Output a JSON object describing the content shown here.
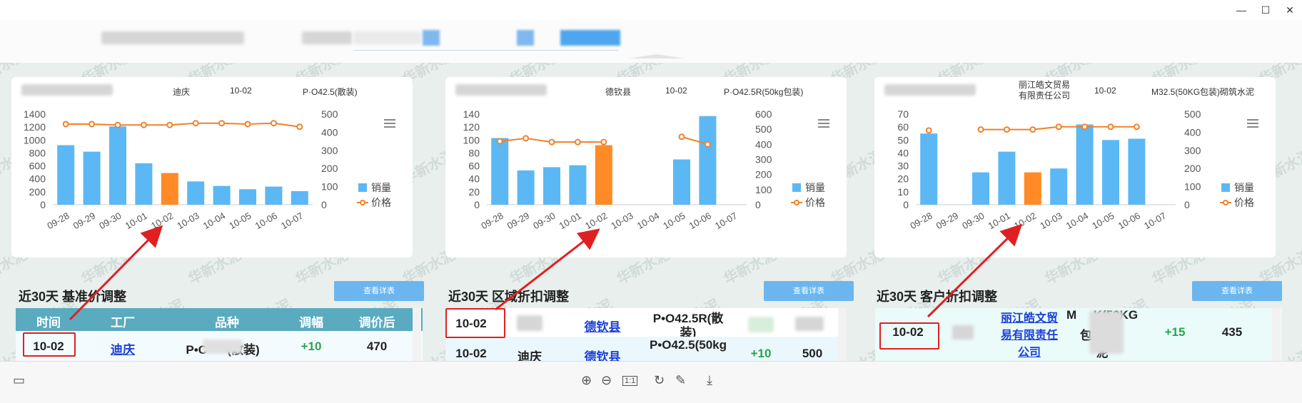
{
  "window": {
    "minimize": "—",
    "maximize": "☐",
    "close": "✕"
  },
  "watermark": "华新水泥",
  "colors": {
    "bar": "#5bb8f5",
    "highlight": "#ff8a26",
    "price": "#f0812a",
    "red": "#e02020",
    "button": "#6bb6ee",
    "table_header": "#5aaac0"
  },
  "legend": {
    "sales": "销量",
    "price": "价格"
  },
  "charts": [
    {
      "info": {
        "region": "迪庆",
        "date": "10-02",
        "product": "P·O42.5(散装)"
      }
    },
    {
      "info": {
        "region": "德钦县",
        "date": "10-02",
        "product": "P·O42.5R(50kg包装)"
      }
    },
    {
      "info": {
        "region": "丽江皓文贸易\n有限责任公司",
        "date": "10-02",
        "product": "M32.5(50KG包装)砌筑水泥"
      }
    }
  ],
  "chart_data": [
    {
      "type": "bar",
      "categories": [
        "09-28",
        "09-29",
        "09-30",
        "10-01",
        "10-02",
        "10-03",
        "10-04",
        "10-05",
        "10-06",
        "10-07"
      ],
      "series": [
        {
          "name": "销量",
          "values": [
            920,
            820,
            1210,
            640,
            490,
            360,
            290,
            240,
            280,
            210
          ]
        },
        {
          "name": "价格",
          "values": [
            445,
            445,
            440,
            440,
            440,
            450,
            450,
            445,
            450,
            430
          ]
        }
      ],
      "highlight_index": 4,
      "left_axis": {
        "ticks": [
          0,
          200,
          400,
          600,
          800,
          1000,
          1200,
          1400
        ],
        "max": 1400
      },
      "right_axis": {
        "ticks": [
          0,
          100,
          200,
          300,
          400,
          500
        ],
        "max": 500
      }
    },
    {
      "type": "bar",
      "categories": [
        "09-28",
        "09-29",
        "09-30",
        "10-01",
        "10-02",
        "10-03",
        "10-04",
        "10-05",
        "10-06",
        "10-07"
      ],
      "series": [
        {
          "name": "销量",
          "values": [
            103,
            53,
            58,
            61,
            92,
            null,
            null,
            70,
            137,
            null
          ]
        },
        {
          "name": "价格",
          "values": [
            420,
            440,
            415,
            415,
            415,
            null,
            null,
            450,
            400,
            null
          ]
        }
      ],
      "highlight_index": 4,
      "left_axis": {
        "ticks": [
          0,
          20,
          40,
          60,
          80,
          100,
          120,
          140
        ],
        "max": 140
      },
      "right_axis": {
        "ticks": [
          0,
          100,
          200,
          300,
          400,
          500,
          600
        ],
        "max": 600
      }
    },
    {
      "type": "bar",
      "categories": [
        "09-28",
        "09-29",
        "09-30",
        "10-01",
        "10-02",
        "10-03",
        "10-04",
        "10-05",
        "10-06",
        "10-07"
      ],
      "series": [
        {
          "name": "销量",
          "values": [
            55,
            null,
            25,
            41,
            25,
            28,
            62,
            50,
            51,
            null
          ]
        },
        {
          "name": "价格",
          "values": [
            410,
            null,
            415,
            415,
            415,
            430,
            430,
            430,
            430,
            null
          ]
        }
      ],
      "highlight_index": 4,
      "left_axis": {
        "ticks": [
          0,
          10,
          20,
          30,
          40,
          50,
          60,
          70
        ],
        "max": 70
      },
      "right_axis": {
        "ticks": [
          0,
          100,
          200,
          300,
          400,
          500
        ],
        "max": 500
      }
    }
  ],
  "sections": [
    {
      "title": "近30天 基准价调整",
      "button": "查看详表",
      "headers": [
        "时间",
        "工厂",
        "品种",
        "调幅",
        "调价后"
      ],
      "row": {
        "time": "10-02",
        "factory": "迪庆",
        "product": "P•C      (散装)",
        "change": "+10",
        "price": "470"
      }
    },
    {
      "title": "近30天 区域折扣调整",
      "button": "查看详表",
      "rows": [
        {
          "time": "10-02",
          "county": "德钦县",
          "product_line1": "P•O42.5R(散",
          "product_line2": "装)"
        },
        {
          "time": "10-02",
          "factory": "迪庆",
          "county": "德钦县",
          "product": "P•O42.5(50kg",
          "change": "+10",
          "price": "500"
        }
      ]
    },
    {
      "title": "近30天 客户折扣调整",
      "button": "查看详表",
      "row": {
        "time": "10-02",
        "customer_line1": "丽江皓文贸",
        "customer_line2": "易有限责任",
        "customer_line3": "公司",
        "product_line1": "M     K(50KG",
        "product_line2": "包装      ",
        "product_line3": "泥",
        "change": "+15",
        "price": "435"
      }
    }
  ],
  "toolbar": {
    "zoom_in": "⊕",
    "zoom_out": "⊖",
    "actual_size": "1:1",
    "rotate": "↻",
    "edit": "✎",
    "download": "⤓",
    "thumbnail": "▭"
  }
}
